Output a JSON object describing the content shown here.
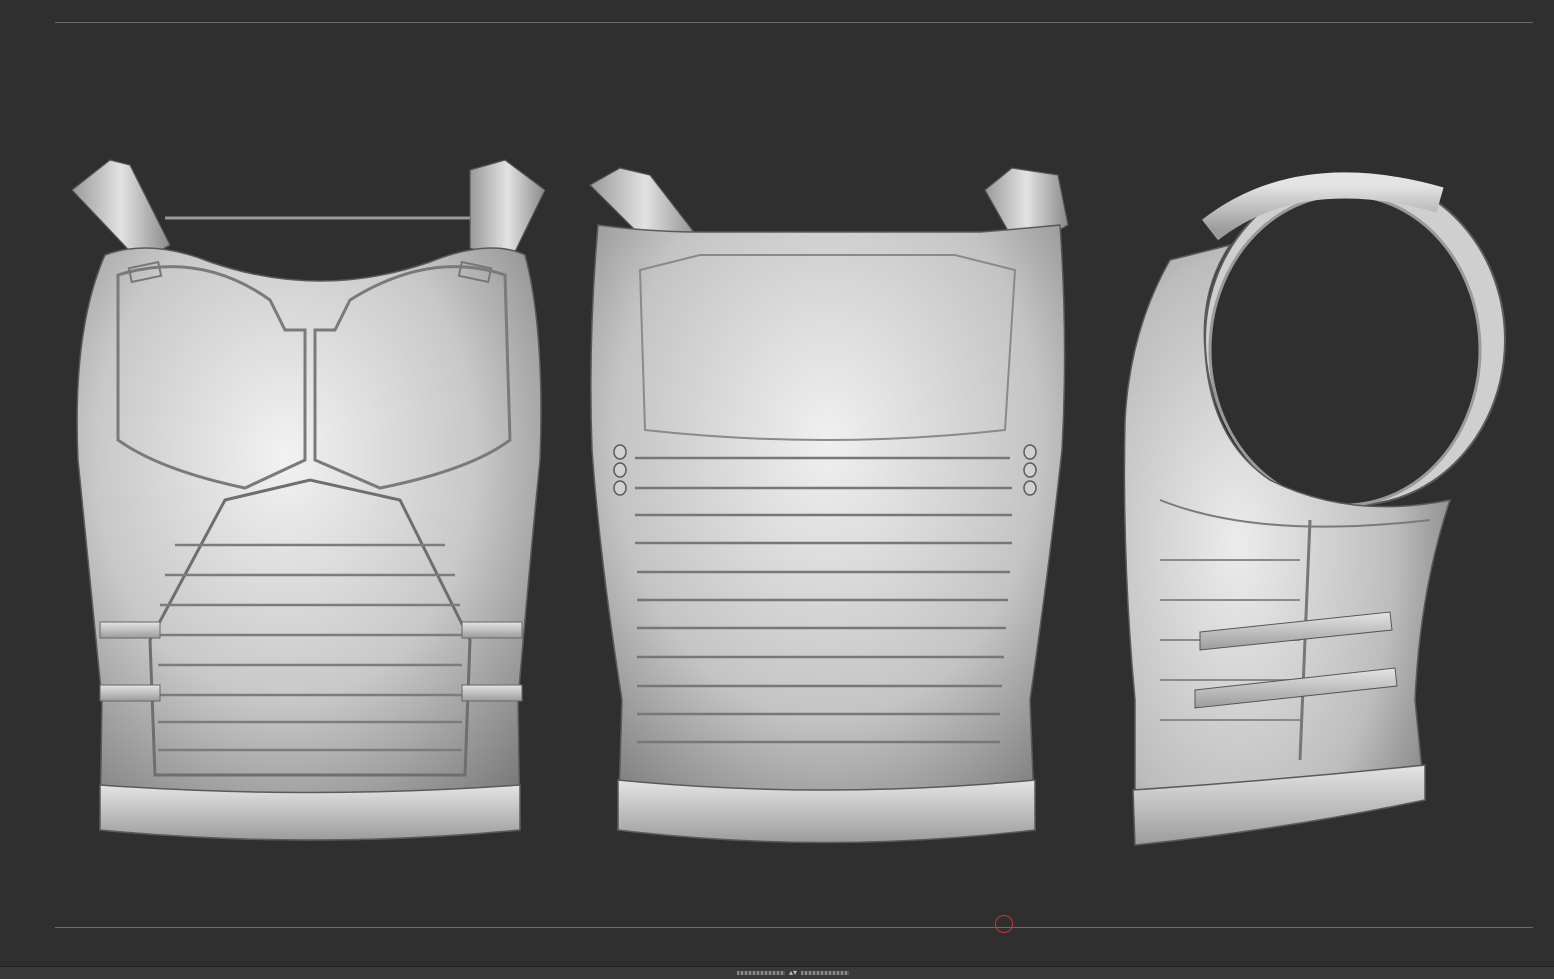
{
  "viewport": {
    "background": "#2f2f2f",
    "views": [
      {
        "name": "front-view"
      },
      {
        "name": "back-view"
      },
      {
        "name": "side-view"
      }
    ]
  },
  "colors": {
    "frame_line": "#6b6b6b",
    "model_light": "#e6e6e6",
    "model_mid": "#b5b5b5",
    "model_dark": "#6e6e6e",
    "cursor_marker": "#c0392b"
  },
  "bottom_tray": {
    "handle_icon": "tray-toggle-arrows-icon",
    "handle_glyph": "▴▾"
  }
}
